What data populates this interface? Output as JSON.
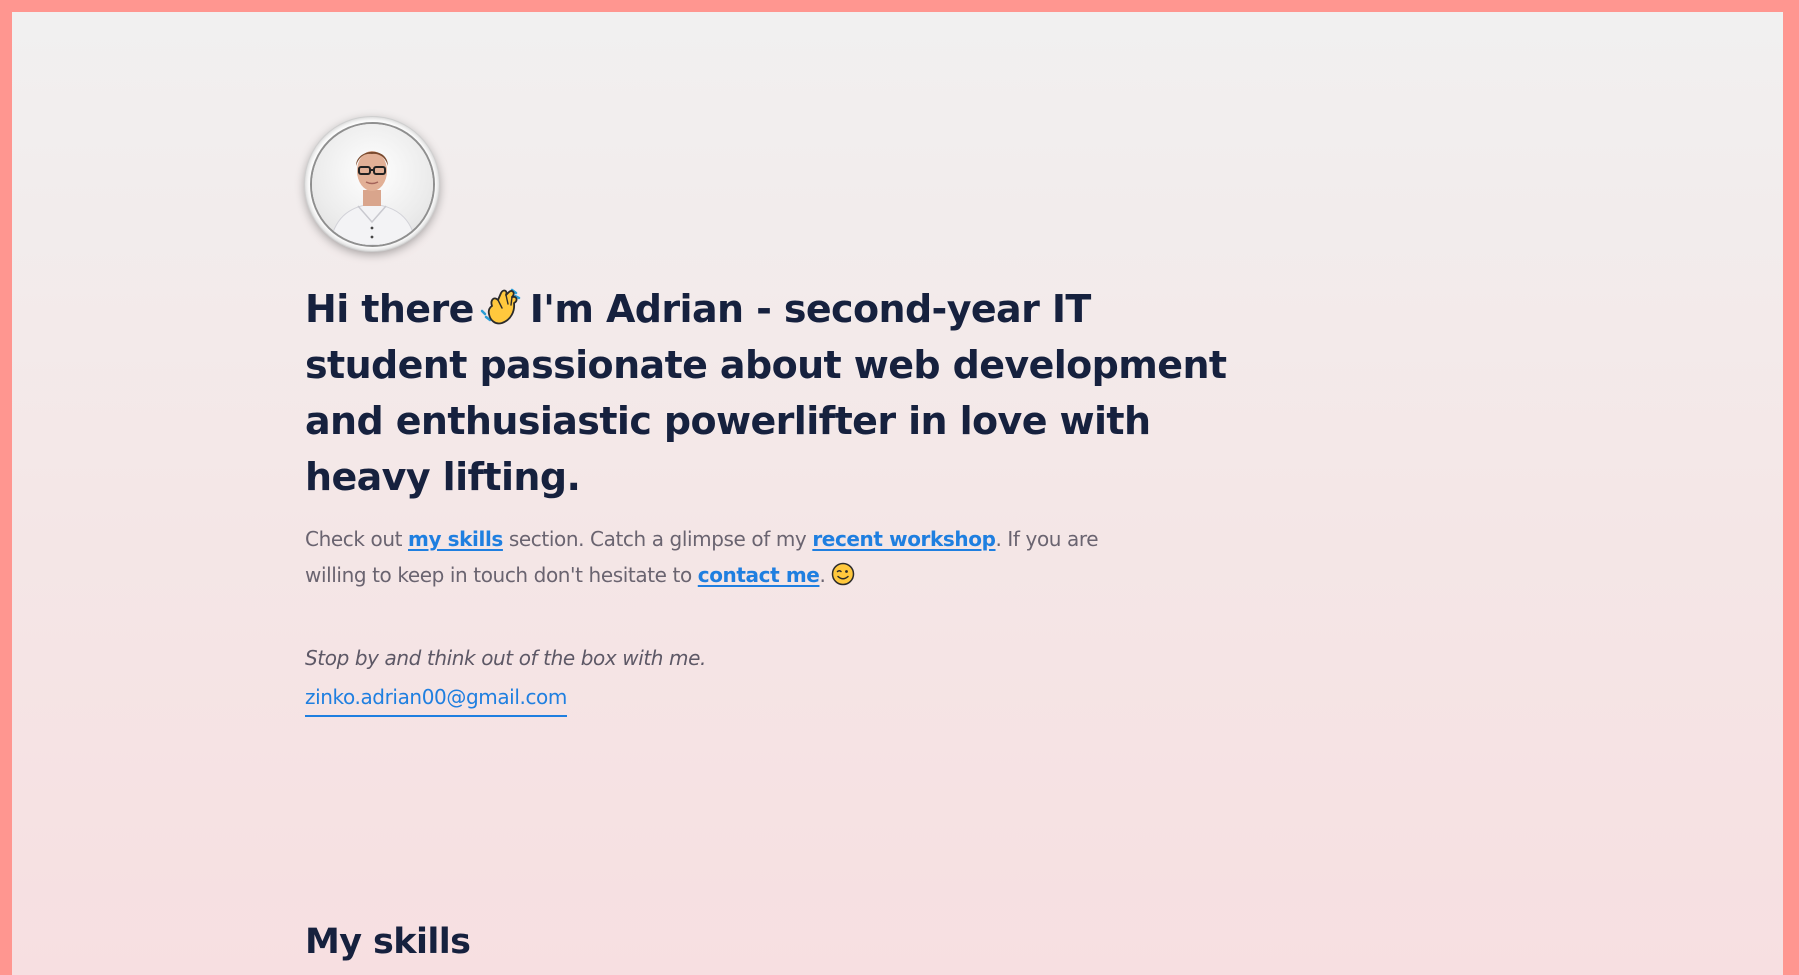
{
  "hero": {
    "avatar_alt": "Adrian profile photo",
    "title_before": "Hi there",
    "title_after": "I'm Adrian - second-year IT student passionate about web development and enthusiastic powerlifter in love with heavy lifting.",
    "wave_icon": "waving-hand-icon"
  },
  "intro": {
    "text_1": "Check out ",
    "link_skills": "my skills",
    "text_2": " section. Catch a glimpse of my ",
    "link_workshop": "recent workshop",
    "text_3": ". If you are willing to keep in touch don't hesitate to ",
    "link_contact": "contact me",
    "text_4": ".",
    "wink_icon": "winking-face-icon"
  },
  "contact": {
    "tagline": "Stop by and think out of the box with me.",
    "email": "zinko.adrian00@gmail.com"
  },
  "sections": {
    "skills_title": "My skills"
  },
  "colors": {
    "frame": "#ff9690",
    "heading": "#16213e",
    "link": "#1f7fe0",
    "body_text": "#6a6470"
  }
}
